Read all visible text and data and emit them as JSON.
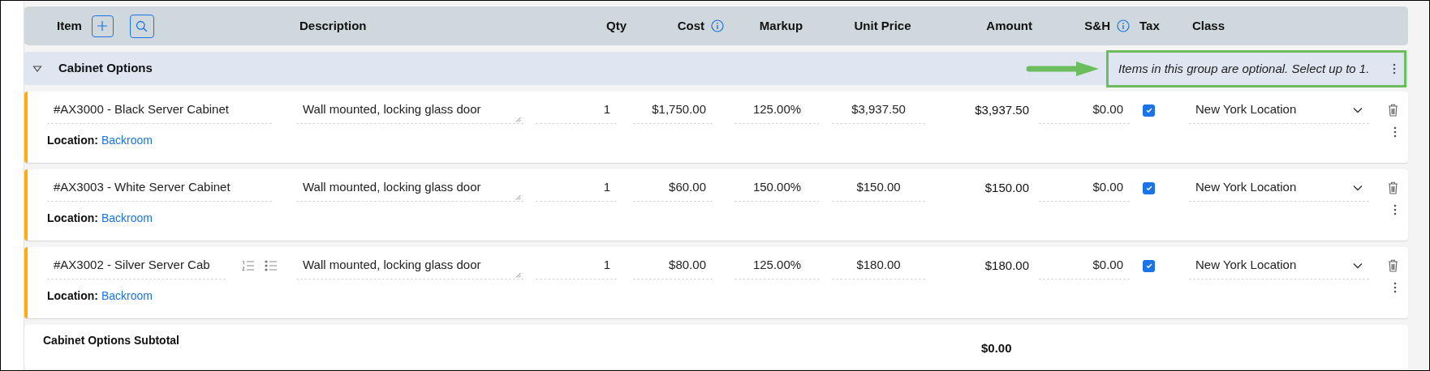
{
  "columns": [
    {
      "label": "Item",
      "kind": "item",
      "info": false
    },
    {
      "label": "Description",
      "kind": "left",
      "info": false
    },
    {
      "label": "Qty",
      "kind": "right",
      "info": false
    },
    {
      "label": "Cost",
      "kind": "right",
      "info": true
    },
    {
      "label": "Markup",
      "kind": "center",
      "info": false
    },
    {
      "label": "Unit Price",
      "kind": "center",
      "info": false
    },
    {
      "label": "Amount",
      "kind": "right",
      "info": false
    },
    {
      "label": "S&H",
      "kind": "right",
      "info": true
    },
    {
      "label": "Tax",
      "kind": "left",
      "info": false
    },
    {
      "label": "Class",
      "kind": "left",
      "info": false
    }
  ],
  "group": {
    "title": "Cabinet Options",
    "expanded": true,
    "note": "Items in this group are optional. Select up to 1."
  },
  "rows": [
    {
      "item": "#AX3000 - Black Server Cabinet",
      "list_icons": false,
      "description": "Wall mounted, locking glass door",
      "qty": "1",
      "cost": "$1,750.00",
      "markup": "125.00%",
      "unit_price": "$3,937.50",
      "amount": "$3,937.50",
      "sh": "$0.00",
      "tax": true,
      "class": "New York Location",
      "location_label": "Location:",
      "location": "Backroom"
    },
    {
      "item": "#AX3003 - White Server Cabinet",
      "list_icons": false,
      "description": "Wall mounted, locking glass door",
      "qty": "1",
      "cost": "$60.00",
      "markup": "150.00%",
      "unit_price": "$150.00",
      "amount": "$150.00",
      "sh": "$0.00",
      "tax": true,
      "class": "New York Location",
      "location_label": "Location:",
      "location": "Backroom"
    },
    {
      "item": "#AX3002 - Silver Server Cab",
      "list_icons": true,
      "description": "Wall mounted, locking glass door",
      "qty": "1",
      "cost": "$80.00",
      "markup": "125.00%",
      "unit_price": "$180.00",
      "amount": "$180.00",
      "sh": "$0.00",
      "tax": true,
      "class": "New York Location",
      "location_label": "Location:",
      "location": "Backroom"
    }
  ],
  "subtotal": {
    "label": "Cabinet Options Subtotal",
    "amount": "$0.00"
  }
}
